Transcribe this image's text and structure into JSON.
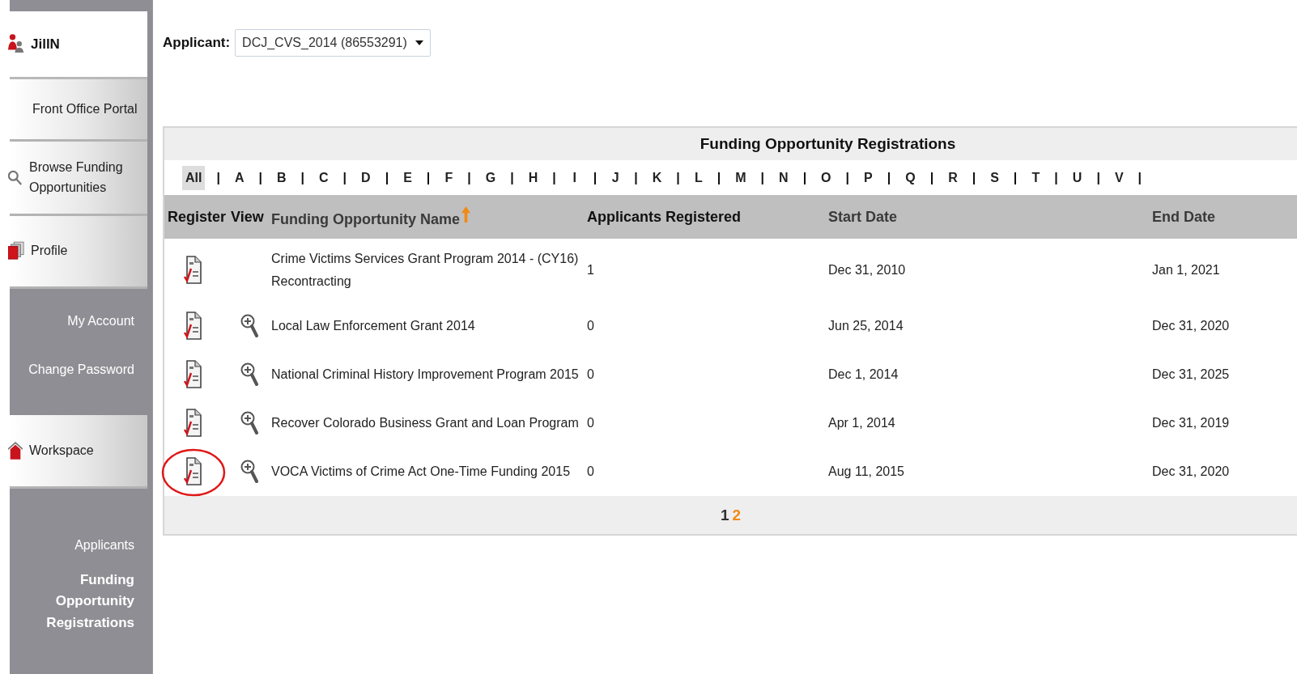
{
  "sidebar": [
    {
      "kind": "user",
      "label": "JillN"
    },
    {
      "kind": "link",
      "label": "Front Office Portal"
    },
    {
      "kind": "search",
      "label": "Browse Funding Opportunities"
    },
    {
      "kind": "profile",
      "label": "Profile"
    },
    {
      "kind": "group",
      "items": [
        {
          "label": "My Account",
          "selected": false
        },
        {
          "label": "Change Password",
          "selected": false
        }
      ]
    },
    {
      "kind": "home",
      "label": "Workspace"
    },
    {
      "kind": "group",
      "items": [
        {
          "label": "Applicants",
          "selected": false
        },
        {
          "label": "Funding Opportunity Registrations",
          "selected": true
        }
      ]
    }
  ],
  "applicant": {
    "label": "Applicant:",
    "value": "DCJ_CVS_2014 (86553291)"
  },
  "table": {
    "title": "Funding Opportunity Registrations",
    "separator": "|",
    "letters": [
      {
        "label": "All",
        "selected": true
      },
      {
        "label": "A",
        "selected": false
      },
      {
        "label": "B",
        "selected": false
      },
      {
        "label": "C",
        "selected": false
      },
      {
        "label": "D",
        "selected": false
      },
      {
        "label": "E",
        "selected": false
      },
      {
        "label": "F",
        "selected": false
      },
      {
        "label": "G",
        "selected": false
      },
      {
        "label": "H",
        "selected": false
      },
      {
        "label": "I",
        "selected": false
      },
      {
        "label": "J",
        "selected": false
      },
      {
        "label": "K",
        "selected": false
      },
      {
        "label": "L",
        "selected": false
      },
      {
        "label": "M",
        "selected": false
      },
      {
        "label": "N",
        "selected": false
      },
      {
        "label": "O",
        "selected": false
      },
      {
        "label": "P",
        "selected": false
      },
      {
        "label": "Q",
        "selected": false
      },
      {
        "label": "R",
        "selected": false
      },
      {
        "label": "S",
        "selected": false
      },
      {
        "label": "T",
        "selected": false
      },
      {
        "label": "U",
        "selected": false
      },
      {
        "label": "V",
        "selected": false
      }
    ],
    "columns": [
      {
        "label": "Register",
        "sortable": false,
        "sorted": false
      },
      {
        "label": "View",
        "sortable": false,
        "sorted": false
      },
      {
        "label": "Funding Opportunity Name",
        "sortable": true,
        "sorted": true
      },
      {
        "label": "Applicants Registered",
        "sortable": false,
        "sorted": false
      },
      {
        "label": "Start Date",
        "sortable": true,
        "sorted": false
      },
      {
        "label": "End Date",
        "sortable": true,
        "sorted": false
      }
    ],
    "rows": [
      {
        "viewable": false,
        "circled": false,
        "name": "Crime Victims Services Grant Program 2014 - (CY16) Recontracting",
        "applicants": "1",
        "start": "Dec 31, 2010",
        "end": "Jan 1, 2021"
      },
      {
        "viewable": true,
        "circled": false,
        "name": "Local Law Enforcement Grant 2014",
        "applicants": "0",
        "start": "Jun 25, 2014",
        "end": "Dec 31, 2020"
      },
      {
        "viewable": true,
        "circled": false,
        "name": "National Criminal History Improvement Program 2015",
        "applicants": "0",
        "start": "Dec 1, 2014",
        "end": "Dec 31, 2025"
      },
      {
        "viewable": true,
        "circled": false,
        "name": "Recover Colorado Business Grant and Loan Program",
        "applicants": "0",
        "start": "Apr 1, 2014",
        "end": "Dec 31, 2019"
      },
      {
        "viewable": true,
        "circled": true,
        "name": "VOCA Victims of Crime Act One-Time Funding 2015",
        "applicants": "0",
        "start": "Aug 11, 2015",
        "end": "Dec 31, 2020"
      }
    ],
    "pages": [
      {
        "label": "1",
        "selected": true
      },
      {
        "label": "2",
        "selected": false
      }
    ]
  }
}
